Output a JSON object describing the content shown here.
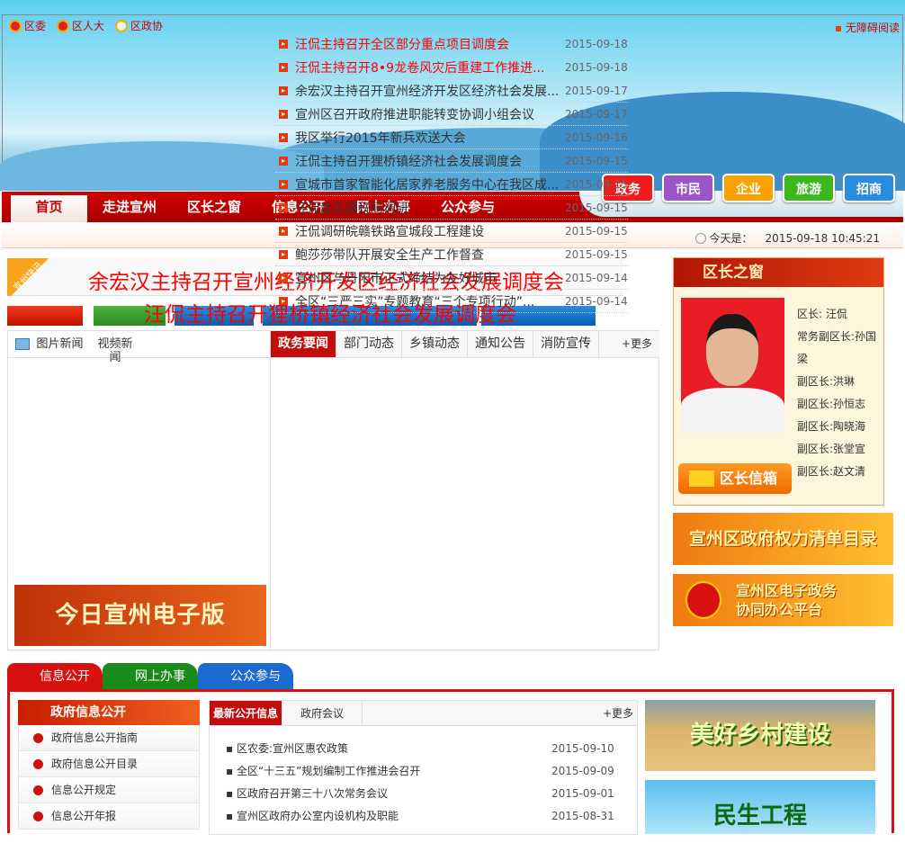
{
  "top_links": [
    "区委",
    "区人大",
    "区政协"
  ],
  "accessibility": "无障碍阅读",
  "nav": [
    "首页",
    "走进宣州",
    "区长之窗",
    "信息公开",
    "网上办事",
    "公众参与"
  ],
  "channels": [
    {
      "label": "政务",
      "color": "#ee1c1c"
    },
    {
      "label": "市民",
      "color": "#9a56c8"
    },
    {
      "label": "企业",
      "color": "#f7a200"
    },
    {
      "label": "旅游",
      "color": "#3cb81c"
    },
    {
      "label": "招商",
      "color": "#2a8ce0"
    }
  ],
  "date": {
    "label": "今天是：",
    "value": "2015-09-18 10:45:21"
  },
  "flash": {
    "tag": "宣州快讯",
    "headlines": [
      "余宏汉主持召开宣州经济开发区经济社会发展调度会",
      "汪侃主持召开狸桥镇经济社会发展调度会"
    ]
  },
  "photo_tabs": [
    "图片新闻",
    "视频新闻"
  ],
  "news_tabs": [
    "政务要闻",
    "部门动态",
    "乡镇动态",
    "通知公告",
    "消防宣传"
  ],
  "more": "+更多",
  "news": [
    {
      "title": "汪侃主持召开全区部分重点项目调度会",
      "date": "2015-09-18",
      "red": true
    },
    {
      "title": "汪侃主持召开8•9龙卷风灾后重建工作推进...",
      "date": "2015-09-18",
      "red": true
    },
    {
      "title": "余宏汉主持召开宣州经济开发区经济社会发展...",
      "date": "2015-09-17"
    },
    {
      "title": "宣州区召开政府推进职能转变协调小组会议",
      "date": "2015-09-17"
    },
    {
      "title": "我区举行2015年新兵欢送大会",
      "date": "2015-09-16"
    },
    {
      "title": "汪侃主持召开狸桥镇经济社会发展调度会",
      "date": "2015-09-15"
    },
    {
      "title": "宣城市首家智能化居家养老服务中心在我区成...",
      "date": "2015-09-15"
    },
    {
      "title": "汪侃赴区国税局调研",
      "date": "2015-09-15"
    },
    {
      "title": "汪侃调研皖赣铁路宣城段工程建设",
      "date": "2015-09-15"
    },
    {
      "title": "鲍莎莎带队开展安全生产工作督查",
      "date": "2015-09-15"
    },
    {
      "title": "宣州区与丹阳市正式缔结为友好城市",
      "date": "2015-09-14"
    },
    {
      "title": "全区“三严三实”专题教育“三个专项行动”...",
      "date": "2015-09-14"
    }
  ],
  "epaper": "今日宣州电子版",
  "leader": {
    "title": "区长之窗",
    "names": [
      "区长: 汪侃",
      "常务副区长:孙国梁",
      "副区长:洪琳",
      "副区长:孙恒志",
      "副区长:陶晓海",
      "副区长:张堂宣",
      "副区长:赵文清"
    ],
    "mailbox": "区长信箱"
  },
  "promo1": "宣州区政府权力清单目录",
  "promo2": [
    "宣州区电子政务",
    "协同办公平台"
  ],
  "bottom_tabs": [
    {
      "label": "信息公开",
      "color": "#d71010"
    },
    {
      "label": "网上办事",
      "color": "#1a8a1a"
    },
    {
      "label": "公众参与",
      "color": "#1a6ad0"
    }
  ],
  "gov": {
    "title": "政府信息公开",
    "items": [
      "政府信息公开指南",
      "政府信息公开目录",
      "信息公开规定",
      "信息公开年报"
    ]
  },
  "pub_tabs": [
    "最新公开信息",
    "政府会议"
  ],
  "pub": [
    {
      "title": "区农委:宣州区惠农政策",
      "date": "2015-09-10"
    },
    {
      "title": "全区“十三五”规划编制工作推进会召开",
      "date": "2015-09-09"
    },
    {
      "title": "区政府召开第三十八次常务会议",
      "date": "2015-09-01"
    },
    {
      "title": "宣州区政府办公室内设机构及职能",
      "date": "2015-08-31"
    }
  ],
  "img1": "美好乡村建设",
  "img2": "民生工程"
}
